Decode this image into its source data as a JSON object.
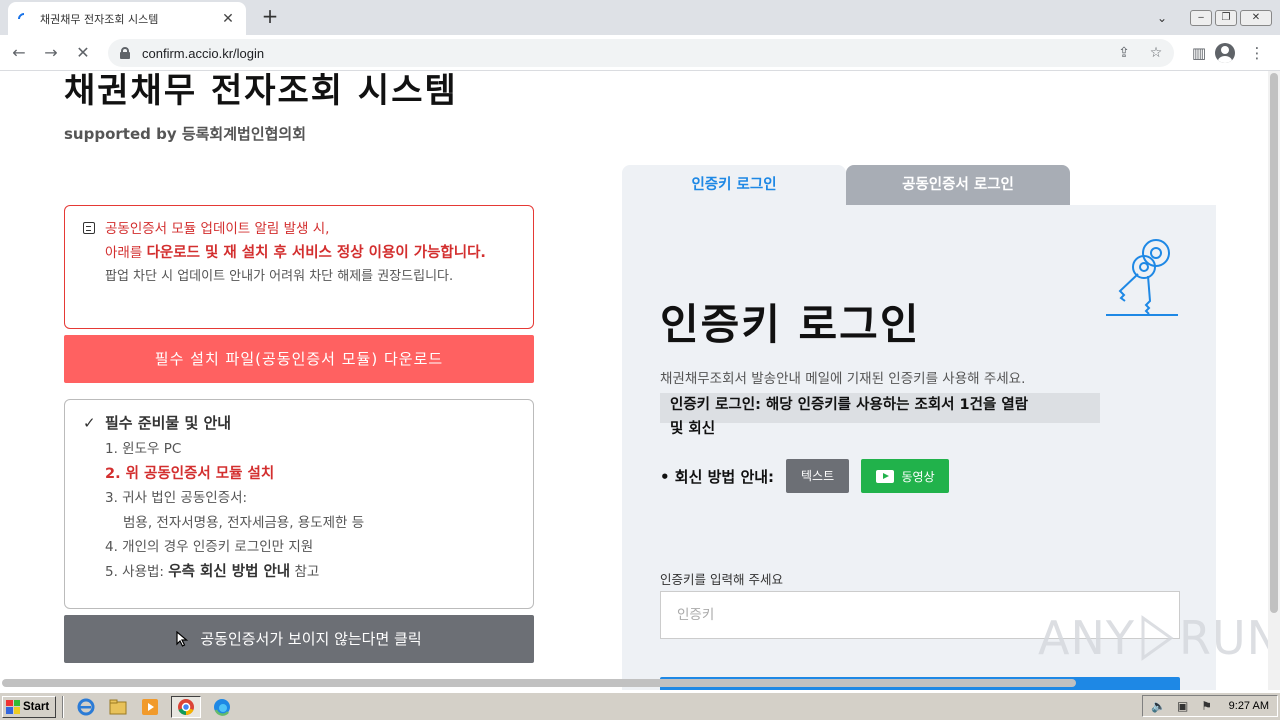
{
  "browser": {
    "tab_title": "채권채무 전자조회 시스템",
    "url": "confirm.accio.kr/login"
  },
  "site": {
    "title": "채권채무 전자조회 시스템",
    "subtitle": "supported by 등록회계법인협의회"
  },
  "notice": {
    "line1": "공동인증서 모듈 업데이트 알림 발생 시,",
    "line2_prefix": "아래를 ",
    "line2_emph": "다운로드 및 재 설치 후 서비스 정상 이용이 가능합니다.",
    "line3": "팝업 차단 시 업데이트 안내가 어려워 차단 해제를 권장드립니다."
  },
  "download_button": "필수 설치 파일(공동인증서 모듈) 다운로드",
  "prep": {
    "heading": "필수 준비물 및 안내",
    "item1": "1. 윈도우 PC",
    "item2": "2. 위 공동인증서 모듈 설치",
    "item3a": "3. 귀사 법인 공동인증서:",
    "item3b": "범용, 전자서명용, 전자세금용, 용도제한 등",
    "item4": "4. 개인의 경우 인증키 로그인만 지원",
    "item5_prefix": "5. 사용법: ",
    "item5_emph": "우측 회신 방법 안내",
    "item5_suffix": " 참고"
  },
  "cert_button": "공동인증서가 보이지 않는다면 클릭",
  "tabs": {
    "key_login": "인증키 로그인",
    "cert_login": "공동인증서 로그인"
  },
  "panel": {
    "title": "인증키 로그인",
    "desc": "채권채무조회서 발송안내 메일에 기재된 인증키를 사용해 주세요.",
    "note_line1": "인증키 로그인: 해당 인증키를 사용하는 조회서 1건을 열람",
    "note_line2": "및 회신",
    "guide_label": "• 회신 방법 안내:",
    "btn_text": "텍스트",
    "btn_video": "동영상",
    "key_label": "인증키를 입력해 주세요",
    "key_placeholder": "인증키"
  },
  "watermark": {
    "left": "ANY",
    "right": "RUN"
  },
  "taskbar": {
    "start": "Start",
    "time": "9:27 AM"
  },
  "colors": {
    "accent_blue": "#1e88e5",
    "alert_red": "#ff6161",
    "video_green": "#21b24b",
    "panel_bg": "#eef1f5"
  }
}
